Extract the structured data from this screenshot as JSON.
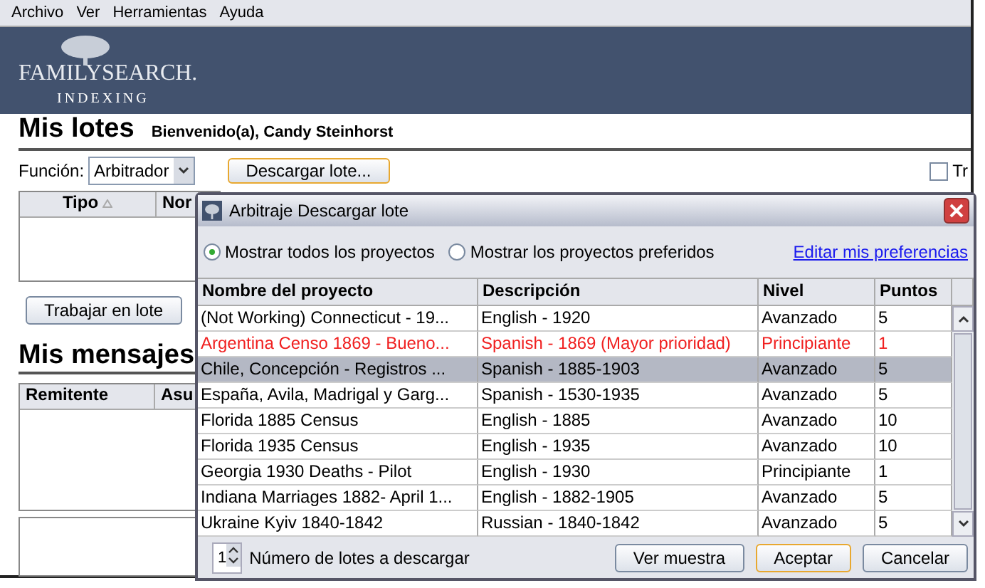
{
  "menu": [
    "Archivo",
    "Ver",
    "Herramientas",
    "Ayuda"
  ],
  "banner": {
    "logo": "FAMILYSEARCH.",
    "subtitle": "INDEXING"
  },
  "lots": {
    "title": "Mis lotes",
    "welcome": "Bienvenido(a), Candy Steinhorst",
    "function_label": "Función:",
    "function_value": "Arbitrador",
    "download_button": "Descargar lote...",
    "checkbox": {
      "label": "Tr",
      "checked": false
    },
    "columns": [
      {
        "label": "Tipo",
        "sorted": true
      },
      {
        "label": "Nor",
        "sorted": false
      }
    ],
    "work_button": "Trabajar en lote"
  },
  "messages": {
    "title": "Mis mensajes",
    "columns": [
      "Remitente",
      "Asu"
    ]
  },
  "dialog": {
    "title": "Arbitraje Descargar lote",
    "filters": [
      {
        "label": "Mostrar todos los proyectos",
        "selected": true
      },
      {
        "label": "Mostrar los proyectos preferidos",
        "selected": false
      }
    ],
    "preferences_link": "Editar mis preferencias",
    "columns": [
      "Nombre del proyecto",
      "Descripción",
      "Nivel",
      "Puntos"
    ],
    "rows": [
      {
        "cells": [
          "(Not Working) Connecticut - 19...",
          "English - 1920",
          "Avanzado",
          "5"
        ],
        "priority": false,
        "selected": false
      },
      {
        "cells": [
          "Argentina Censo 1869 - Bueno...",
          "Spanish - 1869 (Mayor prioridad)",
          "Principiante",
          "1"
        ],
        "priority": true,
        "selected": false
      },
      {
        "cells": [
          "Chile, Concepción - Registros ...",
          "Spanish - 1885-1903",
          "Avanzado",
          "5"
        ],
        "priority": false,
        "selected": true
      },
      {
        "cells": [
          "España, Avila, Madrigal y Garg...",
          "Spanish - 1530-1935",
          "Avanzado",
          "5"
        ],
        "priority": false,
        "selected": false
      },
      {
        "cells": [
          "Florida 1885 Census",
          "English - 1885",
          "Avanzado",
          "10"
        ],
        "priority": false,
        "selected": false
      },
      {
        "cells": [
          "Florida 1935 Census",
          "English - 1935",
          "Avanzado",
          "10"
        ],
        "priority": false,
        "selected": false
      },
      {
        "cells": [
          "Georgia 1930 Deaths - Pilot",
          "English - 1930",
          "Principiante",
          "1"
        ],
        "priority": false,
        "selected": false
      },
      {
        "cells": [
          "Indiana Marriages 1882- April 1...",
          "English - 1882-1905",
          "Avanzado",
          "5"
        ],
        "priority": false,
        "selected": false
      },
      {
        "cells": [
          "Ukraine Kyiv 1840-1842",
          "Russian - 1840-1842",
          "Avanzado",
          "5"
        ],
        "priority": false,
        "selected": false
      }
    ],
    "count_value": "1",
    "count_label": "Número de lotes a descargar",
    "buttons": [
      {
        "label": "Ver muestra",
        "default": false
      },
      {
        "label": "Aceptar",
        "default": true
      },
      {
        "label": "Cancelar",
        "default": false
      }
    ]
  }
}
